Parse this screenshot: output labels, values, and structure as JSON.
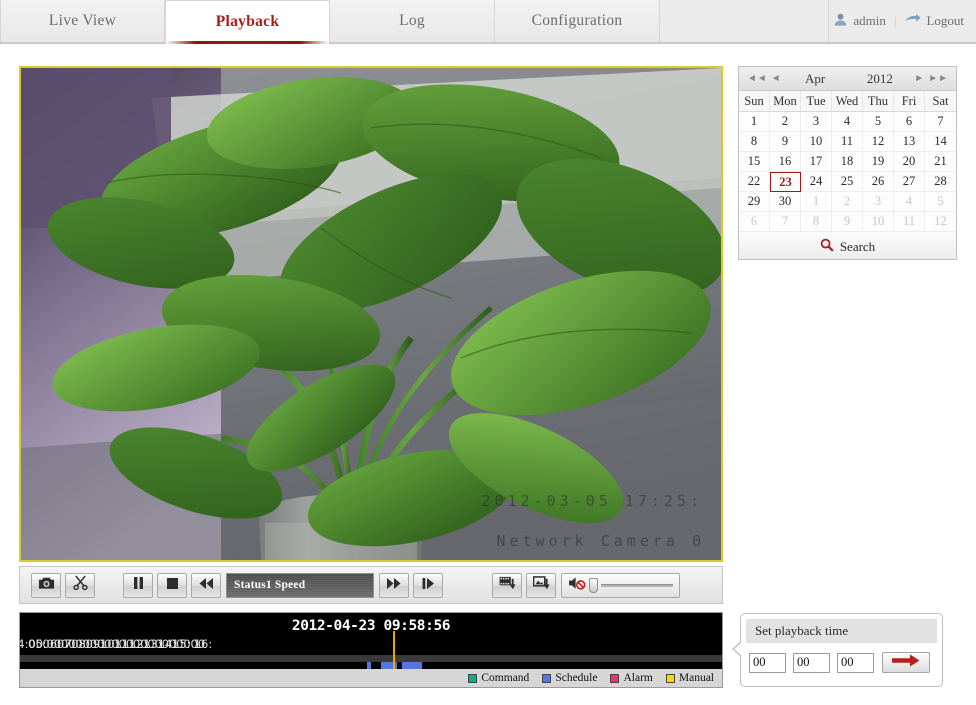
{
  "nav": {
    "tabs": [
      {
        "label": "Live View",
        "active": false
      },
      {
        "label": "Playback",
        "active": true
      },
      {
        "label": "Log",
        "active": false
      },
      {
        "label": "Configuration",
        "active": false
      }
    ],
    "user": {
      "name": "admin",
      "separator": "|",
      "logout": "Logout",
      "user_icon": "user-icon",
      "logout_icon": "logout-arrow-icon"
    }
  },
  "video": {
    "osd_timestamp": "2012-03-05 17:25:",
    "osd_camera_name": "Network Camera 0",
    "border_color": "#d8cb2e"
  },
  "controls": {
    "snapshot_label": "snapshot-icon",
    "clip_label": "scissors-icon",
    "pause_label": "pause-icon",
    "stop_label": "stop-icon",
    "rewind_label": "rewind-icon",
    "status_text": "Status1 Speed",
    "forward_label": "fast-forward-icon",
    "frame_label": "frame-step-icon",
    "download_video_label": "download-video-icon",
    "download_picture_label": "download-picture-icon",
    "volume_label": "speaker-muted-icon",
    "volume_value": 0
  },
  "timeline": {
    "current_time": "2012-04-23 09:58:56",
    "ticks": [
      {
        "label": "4:00",
        "pos": 10.2
      },
      {
        "label": "05:00",
        "pos": 24.6
      },
      {
        "label": "06:00",
        "pos": 39.0
      },
      {
        "label": "07:00",
        "pos": 53.4
      },
      {
        "label": "08:00",
        "pos": 67.8
      },
      {
        "label": "09:00",
        "pos": 82.2
      },
      {
        "label": "10:00",
        "pos": 96.6
      },
      {
        "label": "11:00",
        "pos": 111.0
      },
      {
        "label": "12:00",
        "pos": 125.4
      },
      {
        "label": "13:00",
        "pos": 139.8
      },
      {
        "label": "14:00",
        "pos": 154.2
      },
      {
        "label": "15:00",
        "pos": 168.6
      },
      {
        "label": "16:",
        "pos": 183.0
      }
    ],
    "segments": [
      {
        "type": "Schedule",
        "left_pct": 49.4,
        "width_pct": 0.6,
        "color": "#5577dd"
      },
      {
        "type": "Schedule",
        "left_pct": 51.4,
        "width_pct": 2.3,
        "color": "#5577dd"
      },
      {
        "type": "Schedule",
        "left_pct": 54.4,
        "width_pct": 2.9,
        "color": "#5577dd"
      }
    ],
    "playhead_pct": 53.2,
    "legend": [
      {
        "label": "Command",
        "color": "#00b386"
      },
      {
        "label": "Schedule",
        "color": "#5577dd"
      },
      {
        "label": "Alarm",
        "color": "#e8336e"
      },
      {
        "label": "Manual",
        "color": "#ffd700"
      }
    ]
  },
  "calendar": {
    "prev_year_icon": "double-left-icon",
    "prev_month_icon": "left-icon",
    "month": "Apr",
    "year": "2012",
    "next_month_icon": "right-icon",
    "next_year_icon": "double-right-icon",
    "weekdays": [
      "Sun",
      "Mon",
      "Tue",
      "Wed",
      "Thu",
      "Fri",
      "Sat"
    ],
    "days": [
      {
        "d": "1",
        "o": false
      },
      {
        "d": "2",
        "o": false
      },
      {
        "d": "3",
        "o": false
      },
      {
        "d": "4",
        "o": false
      },
      {
        "d": "5",
        "o": false
      },
      {
        "d": "6",
        "o": false
      },
      {
        "d": "7",
        "o": false
      },
      {
        "d": "8",
        "o": false
      },
      {
        "d": "9",
        "o": false
      },
      {
        "d": "10",
        "o": false
      },
      {
        "d": "11",
        "o": false
      },
      {
        "d": "12",
        "o": false
      },
      {
        "d": "13",
        "o": false
      },
      {
        "d": "14",
        "o": false
      },
      {
        "d": "15",
        "o": false
      },
      {
        "d": "16",
        "o": false
      },
      {
        "d": "17",
        "o": false
      },
      {
        "d": "18",
        "o": false
      },
      {
        "d": "19",
        "o": false
      },
      {
        "d": "20",
        "o": false
      },
      {
        "d": "21",
        "o": false
      },
      {
        "d": "22",
        "o": false
      },
      {
        "d": "23",
        "o": false,
        "sel": true
      },
      {
        "d": "24",
        "o": false
      },
      {
        "d": "25",
        "o": false
      },
      {
        "d": "26",
        "o": false
      },
      {
        "d": "27",
        "o": false
      },
      {
        "d": "28",
        "o": false
      },
      {
        "d": "29",
        "o": false
      },
      {
        "d": "30",
        "o": false
      },
      {
        "d": "1",
        "o": true
      },
      {
        "d": "2",
        "o": true
      },
      {
        "d": "3",
        "o": true
      },
      {
        "d": "4",
        "o": true
      },
      {
        "d": "5",
        "o": true
      },
      {
        "d": "6",
        "o": true
      },
      {
        "d": "7",
        "o": true
      },
      {
        "d": "8",
        "o": true
      },
      {
        "d": "9",
        "o": true
      },
      {
        "d": "10",
        "o": true
      },
      {
        "d": "11",
        "o": true
      },
      {
        "d": "12",
        "o": true
      }
    ],
    "selected_day": "23",
    "search_label": "Search",
    "search_icon": "search-icon"
  },
  "set_playback": {
    "title": "Set playback time",
    "hours": "00",
    "minutes": "00",
    "seconds": "00",
    "go_icon": "arrow-right-icon"
  },
  "colors": {
    "accent_red": "#a81b19",
    "video_border": "#d8cb2e",
    "playhead": "#f0a400"
  }
}
